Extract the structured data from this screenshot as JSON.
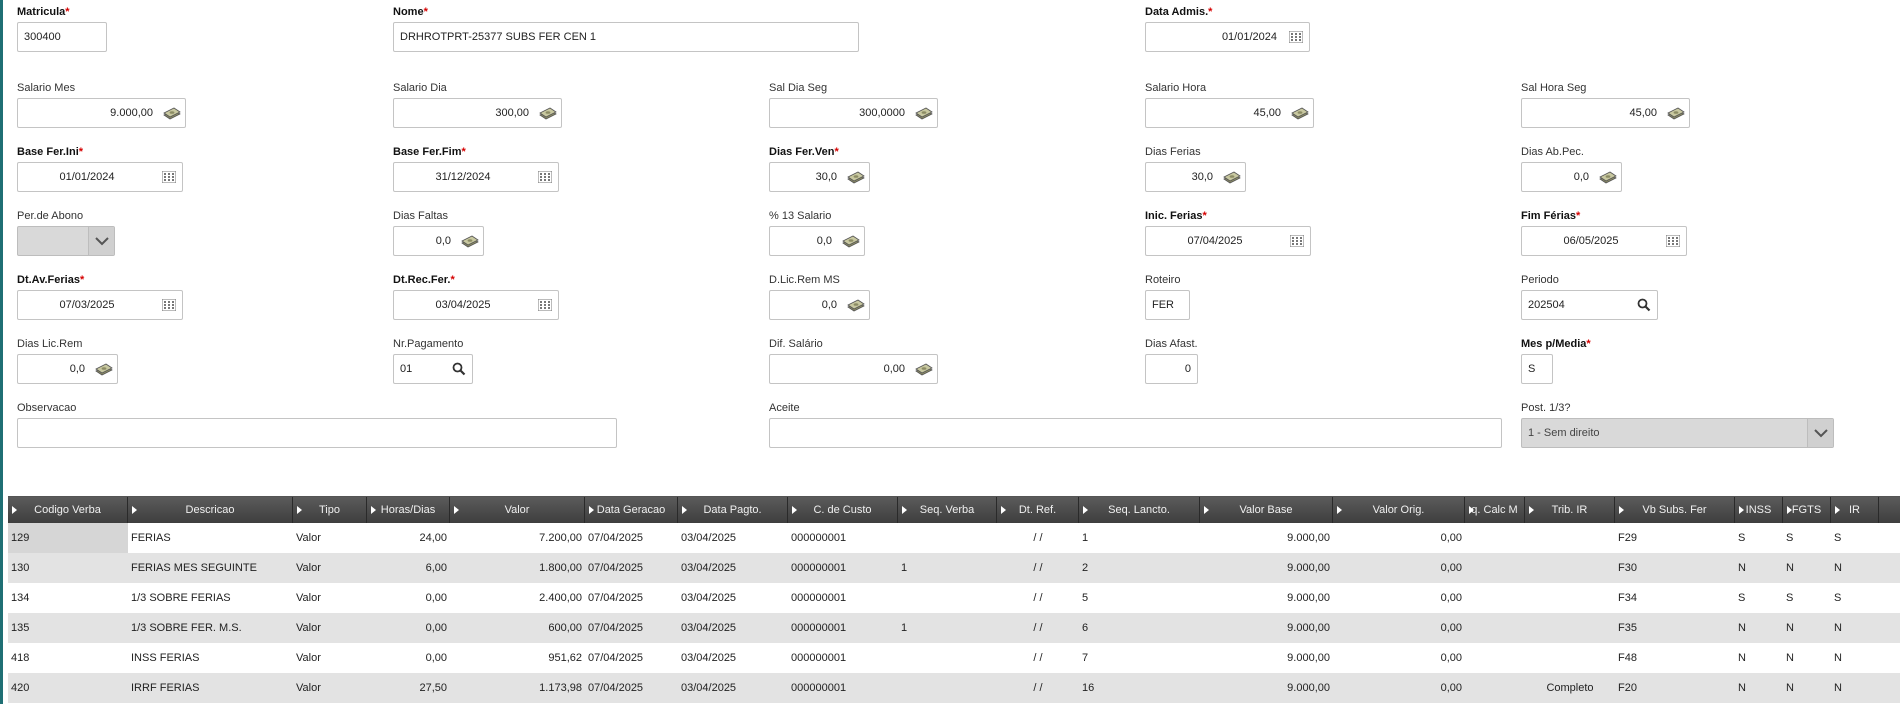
{
  "form": {
    "matricula": {
      "label": "Matricula",
      "value": "300400"
    },
    "nome": {
      "label": "Nome",
      "value": "DRHROTPRT-25377 SUBS FER CEN 1"
    },
    "data_admis": {
      "label": "Data Admis.",
      "value": "01/01/2024"
    },
    "salario_mes": {
      "label": "Salario Mes",
      "value": "9.000,00"
    },
    "salario_dia": {
      "label": "Salario Dia",
      "value": "300,00"
    },
    "sal_dia_seg": {
      "label": "Sal Dia Seg",
      "value": "300,0000"
    },
    "salario_hora": {
      "label": "Salario Hora",
      "value": "45,00"
    },
    "sal_hora_seg": {
      "label": "Sal Hora Seg",
      "value": "45,00"
    },
    "base_fer_ini": {
      "label": "Base Fer.Ini",
      "value": "01/01/2024"
    },
    "base_fer_fim": {
      "label": "Base Fer.Fim",
      "value": "31/12/2024"
    },
    "dias_fer_ven": {
      "label": "Dias Fer.Ven",
      "value": "30,0"
    },
    "dias_ferias": {
      "label": "Dias Ferias",
      "value": "30,0"
    },
    "dias_ab_pec": {
      "label": "Dias Ab.Pec.",
      "value": "0,0"
    },
    "per_abono": {
      "label": "Per.de Abono",
      "value": ""
    },
    "dias_faltas": {
      "label": "Dias Faltas",
      "value": "0,0"
    },
    "pct_13_salario": {
      "label": "% 13 Salario",
      "value": "0,0"
    },
    "inic_ferias": {
      "label": "Inic. Ferias",
      "value": "07/04/2025"
    },
    "fim_ferias": {
      "label": "Fim Férias",
      "value": "06/05/2025"
    },
    "dt_av_ferias": {
      "label": "Dt.Av.Ferias",
      "value": "07/03/2025"
    },
    "dt_rec_fer": {
      "label": "Dt.Rec.Fer.",
      "value": "03/04/2025"
    },
    "d_lic_rem_ms": {
      "label": "D.Lic.Rem MS",
      "value": "0,0"
    },
    "roteiro": {
      "label": "Roteiro",
      "value": "FER"
    },
    "periodo": {
      "label": "Periodo",
      "value": "202504"
    },
    "dias_lic_rem": {
      "label": "Dias Lic.Rem",
      "value": "0,0"
    },
    "nr_pagamento": {
      "label": "Nr.Pagamento",
      "value": "01"
    },
    "dif_salario": {
      "label": "Dif. Salário",
      "value": "0,00"
    },
    "dias_afast": {
      "label": "Dias Afast.",
      "value": "0"
    },
    "mes_p_media": {
      "label": "Mes p/Media",
      "value": "S"
    },
    "observacao": {
      "label": "Observacao",
      "value": ""
    },
    "aceite": {
      "label": "Aceite",
      "value": ""
    },
    "post_1_3": {
      "label": "Post. 1/3?",
      "value": "1 - Sem direito"
    }
  },
  "grid": {
    "columns": [
      "Codigo Verba",
      "Descricao",
      "Tipo",
      "Horas/Dias",
      "Valor",
      "Data Geracao",
      "Data Pagto.",
      "C. de Custo",
      "Seq. Verba",
      "Dt. Ref.",
      "Seq. Lancto.",
      "Valor Base",
      "Valor Orig.",
      "q. Calc M",
      "Trib. IR",
      "Vb Subs. Fer",
      "INSS",
      "FGTS",
      "IR"
    ],
    "rows": [
      [
        "129",
        "FERIAS",
        "Valor",
        "24,00",
        "7.200,00",
        "07/04/2025",
        "03/04/2025",
        "000000001",
        "",
        "/  /",
        "1",
        "9.000,00",
        "0,00",
        "",
        "",
        "F29",
        "S",
        "S",
        "S"
      ],
      [
        "130",
        "FERIAS MES SEGUINTE",
        "Valor",
        "6,00",
        "1.800,00",
        "07/04/2025",
        "03/04/2025",
        "000000001",
        "1",
        "/  /",
        "2",
        "9.000,00",
        "0,00",
        "",
        "",
        "F30",
        "N",
        "N",
        "N"
      ],
      [
        "134",
        "1/3 SOBRE FERIAS",
        "Valor",
        "0,00",
        "2.400,00",
        "07/04/2025",
        "03/04/2025",
        "000000001",
        "",
        "/  /",
        "5",
        "9.000,00",
        "0,00",
        "",
        "",
        "F34",
        "S",
        "S",
        "S"
      ],
      [
        "135",
        "1/3 SOBRE FER. M.S.",
        "Valor",
        "0,00",
        "600,00",
        "07/04/2025",
        "03/04/2025",
        "000000001",
        "1",
        "/  /",
        "6",
        "9.000,00",
        "0,00",
        "",
        "",
        "F35",
        "N",
        "N",
        "N"
      ],
      [
        "418",
        "INSS FERIAS",
        "Valor",
        "0,00",
        "951,62",
        "07/04/2025",
        "03/04/2025",
        "000000001",
        "",
        "/  /",
        "7",
        "9.000,00",
        "0,00",
        "",
        "",
        "F48",
        "N",
        "N",
        "N"
      ],
      [
        "420",
        "IRRF FERIAS",
        "Valor",
        "27,50",
        "1.173,98",
        "07/04/2025",
        "03/04/2025",
        "000000001",
        "",
        "/  /",
        "16",
        "9.000,00",
        "0,00",
        "",
        "Completo",
        "F20",
        "N",
        "N",
        "N"
      ]
    ]
  },
  "icons": {
    "calendar": "calendar-icon",
    "money": "money-icon",
    "search": "search-icon",
    "dropdown": "chevron-down-icon"
  }
}
